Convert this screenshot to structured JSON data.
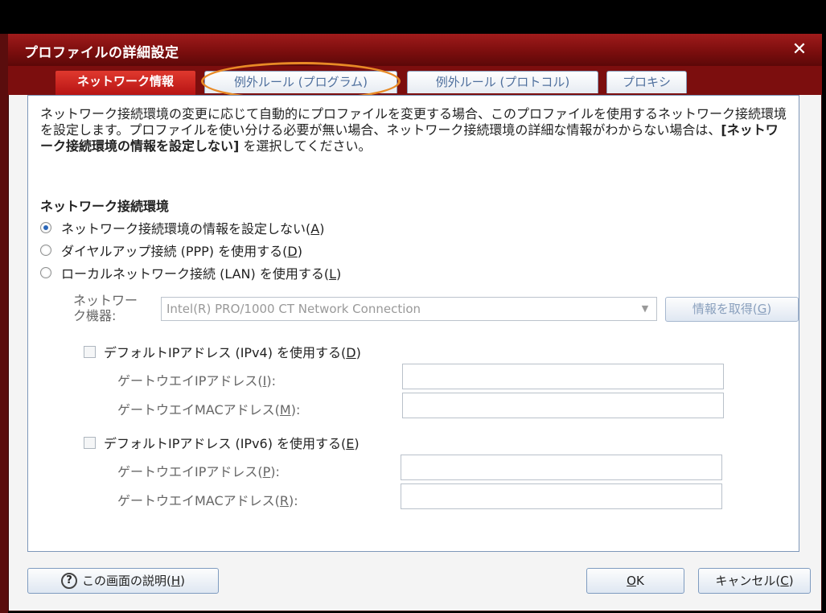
{
  "dialog": {
    "title": "プロファイルの詳細設定",
    "close_glyph": "✕"
  },
  "tabs": [
    {
      "label": "ネットワーク情報",
      "active": true
    },
    {
      "label": "例外ルール (プログラム)",
      "active": false,
      "highlighted": true
    },
    {
      "label": "例外ルール (プロトコル)",
      "active": false
    },
    {
      "label": "プロキシ",
      "active": false
    }
  ],
  "description": {
    "part1": "ネットワーク接続環境の変更に応じて自動的にプロファイルを変更する場合、このプロファイルを使用するネットワーク接続環境を設定します。プロファイルを使い分ける必要が無い場合、ネットワーク接続環境の詳細な情報がわからない場合は、",
    "bold": "[ネットワーク接続環境の情報を設定しない]",
    "part2": " を選択してください。"
  },
  "network_env": {
    "title": "ネットワーク接続環境",
    "options": [
      {
        "prefix": "ネットワーク接続環境の情報を設定しない(",
        "key": "A",
        "suffix": ")",
        "checked": true
      },
      {
        "prefix": "ダイヤルアップ接続 (PPP) を使用する(",
        "key": "D",
        "suffix": ")",
        "checked": false
      },
      {
        "prefix": "ローカルネットワーク接続 (LAN) を使用する(",
        "key": "L",
        "suffix": ")",
        "checked": false
      }
    ]
  },
  "device": {
    "label": "ネットワーク機器:",
    "value": "Intel(R) PRO/1000 CT Network Connection",
    "get_info": {
      "prefix": "情報を取得(",
      "key": "G",
      "suffix": ")"
    }
  },
  "ipv4": {
    "checkbox": {
      "prefix": "デフォルトIPアドレス (IPv4) を使用する(",
      "key": "D",
      "suffix": ")",
      "checked": false
    },
    "gateway_ip": {
      "prefix": "ゲートウエイIPアドレス(",
      "key": "I",
      "suffix": "):",
      "value": ""
    },
    "gateway_mac": {
      "prefix": "ゲートウエイMACアドレス(",
      "key": "M",
      "suffix": "):",
      "value": ""
    }
  },
  "ipv6": {
    "checkbox": {
      "prefix": "デフォルトIPアドレス (IPv6) を使用する(",
      "key": "E",
      "suffix": ")",
      "checked": false
    },
    "gateway_ip": {
      "prefix": "ゲートウエイIPアドレス(",
      "key": "P",
      "suffix": "):",
      "value": ""
    },
    "gateway_mac": {
      "prefix": "ゲートウエイMACアドレス(",
      "key": "R",
      "suffix": "):",
      "value": ""
    }
  },
  "footer": {
    "help": {
      "icon": "?",
      "prefix": "この画面の説明(",
      "key": "H",
      "suffix": ")"
    },
    "ok": {
      "key": "O",
      "suffix": "K"
    },
    "cancel": {
      "prefix": "キャンセル(",
      "key": "C",
      "suffix": ")"
    }
  },
  "colors": {
    "titlebar": "#8a1212",
    "active_tab": "#c8201a",
    "highlight": "#e88a26",
    "tab_text": "#4e6f9d"
  }
}
